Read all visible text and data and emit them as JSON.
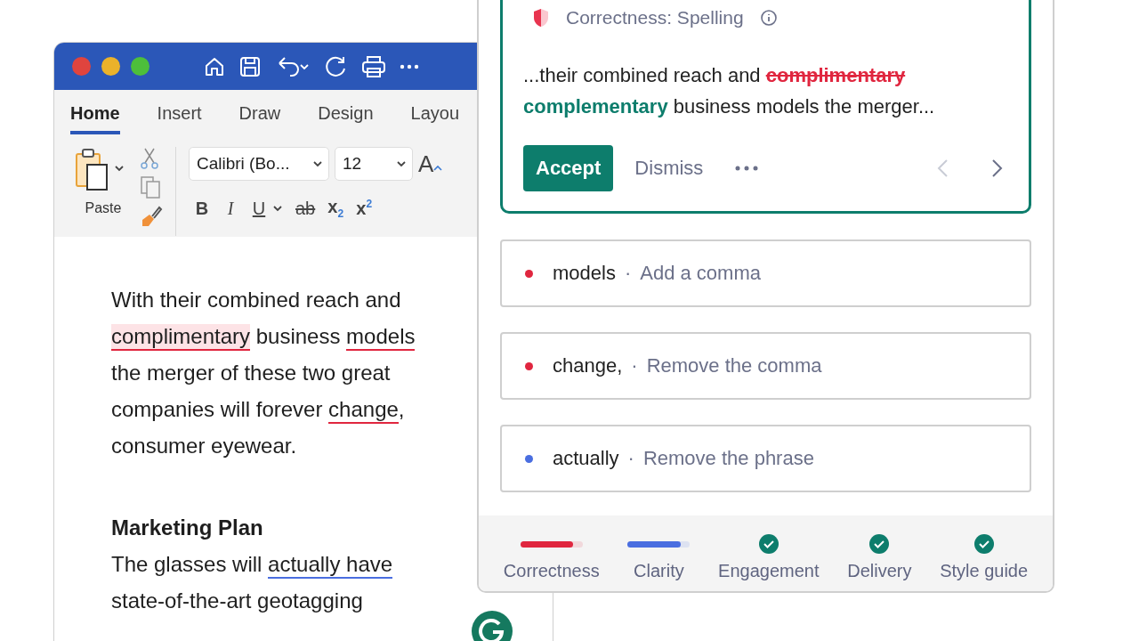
{
  "word": {
    "tabs": [
      {
        "label": "Home",
        "selected": true
      },
      {
        "label": "Insert",
        "selected": false
      },
      {
        "label": "Draw",
        "selected": false
      },
      {
        "label": "Design",
        "selected": false
      },
      {
        "label": "Layou",
        "selected": false
      }
    ],
    "paste_label": "Paste",
    "font_name": "Calibri (Bo...",
    "font_size": "12",
    "grow_font": "A",
    "format_buttons": [
      {
        "label": "B",
        "kind": "bold"
      },
      {
        "label": "I",
        "kind": "italic"
      },
      {
        "label": "U",
        "kind": "underline"
      },
      {
        "label": "ab",
        "kind": "strikethrough"
      },
      {
        "label": "x$_{2}$",
        "kind": "subscript"
      },
      {
        "label": "x$^{2}$",
        "kind": "superscript"
      }
    ],
    "document": [
      {
        "kind": "paragraph",
        "lines": [
          [
            {
              "text": "With their combined reach and"
            }
          ],
          [
            {
              "text": "complimentary",
              "kind": "correctness",
              "highlighted": true
            },
            {
              "text": " business "
            },
            {
              "text": "models",
              "kind": "correctness",
              "highlighted": false
            }
          ],
          [
            {
              "text": "the merger of these two great"
            }
          ],
          [
            {
              "text": "companies will forever "
            },
            {
              "text": "change",
              "kind": "correctness",
              "highlighted": false
            },
            {
              "text": ","
            }
          ],
          [
            {
              "text": "consumer eyewear."
            }
          ]
        ]
      },
      {
        "kind": "heading",
        "text": "Marketing Plan"
      },
      {
        "kind": "paragraph",
        "lines": [
          [
            {
              "text": "The glasses will "
            },
            {
              "text": "actually have",
              "kind": "clarity",
              "highlighted": false
            }
          ],
          [
            {
              "text": "state-of-the-art geotagging"
            }
          ]
        ]
      }
    ]
  },
  "assistant": {
    "card": {
      "title": "Correctness: Spelling",
      "snippet": [
        {
          "kind": "plain",
          "text": "...their combined reach and "
        },
        {
          "kind": "removed",
          "text": "complimentary"
        },
        {
          "kind": "inserted",
          "text": "complementary"
        },
        {
          "kind": "plain",
          "text": " business models the merger..."
        }
      ],
      "accept": "Accept",
      "dismiss": "Dismiss",
      "previous_disabled": true,
      "next_disabled": false
    },
    "alerts": [
      {
        "word": "models",
        "separator": "·",
        "hint": "Add a comma",
        "color": "#e0263f"
      },
      {
        "word": "change,",
        "separator": "·",
        "hint": "Remove the comma",
        "color": "#e0263f"
      },
      {
        "word": "actually",
        "separator": "·",
        "hint": "Remove the phrase",
        "color": "#4a6ee0"
      }
    ],
    "scores": [
      {
        "label": "Correctness",
        "kind": "bar",
        "level": 0.85,
        "color": "#e0263f"
      },
      {
        "label": "Clarity",
        "kind": "bar",
        "level": 0.85,
        "color": "#4a6ee0"
      },
      {
        "label": "Engagement",
        "kind": "check"
      },
      {
        "label": "Delivery",
        "kind": "check"
      },
      {
        "label": "Style guide",
        "kind": "check"
      }
    ]
  }
}
